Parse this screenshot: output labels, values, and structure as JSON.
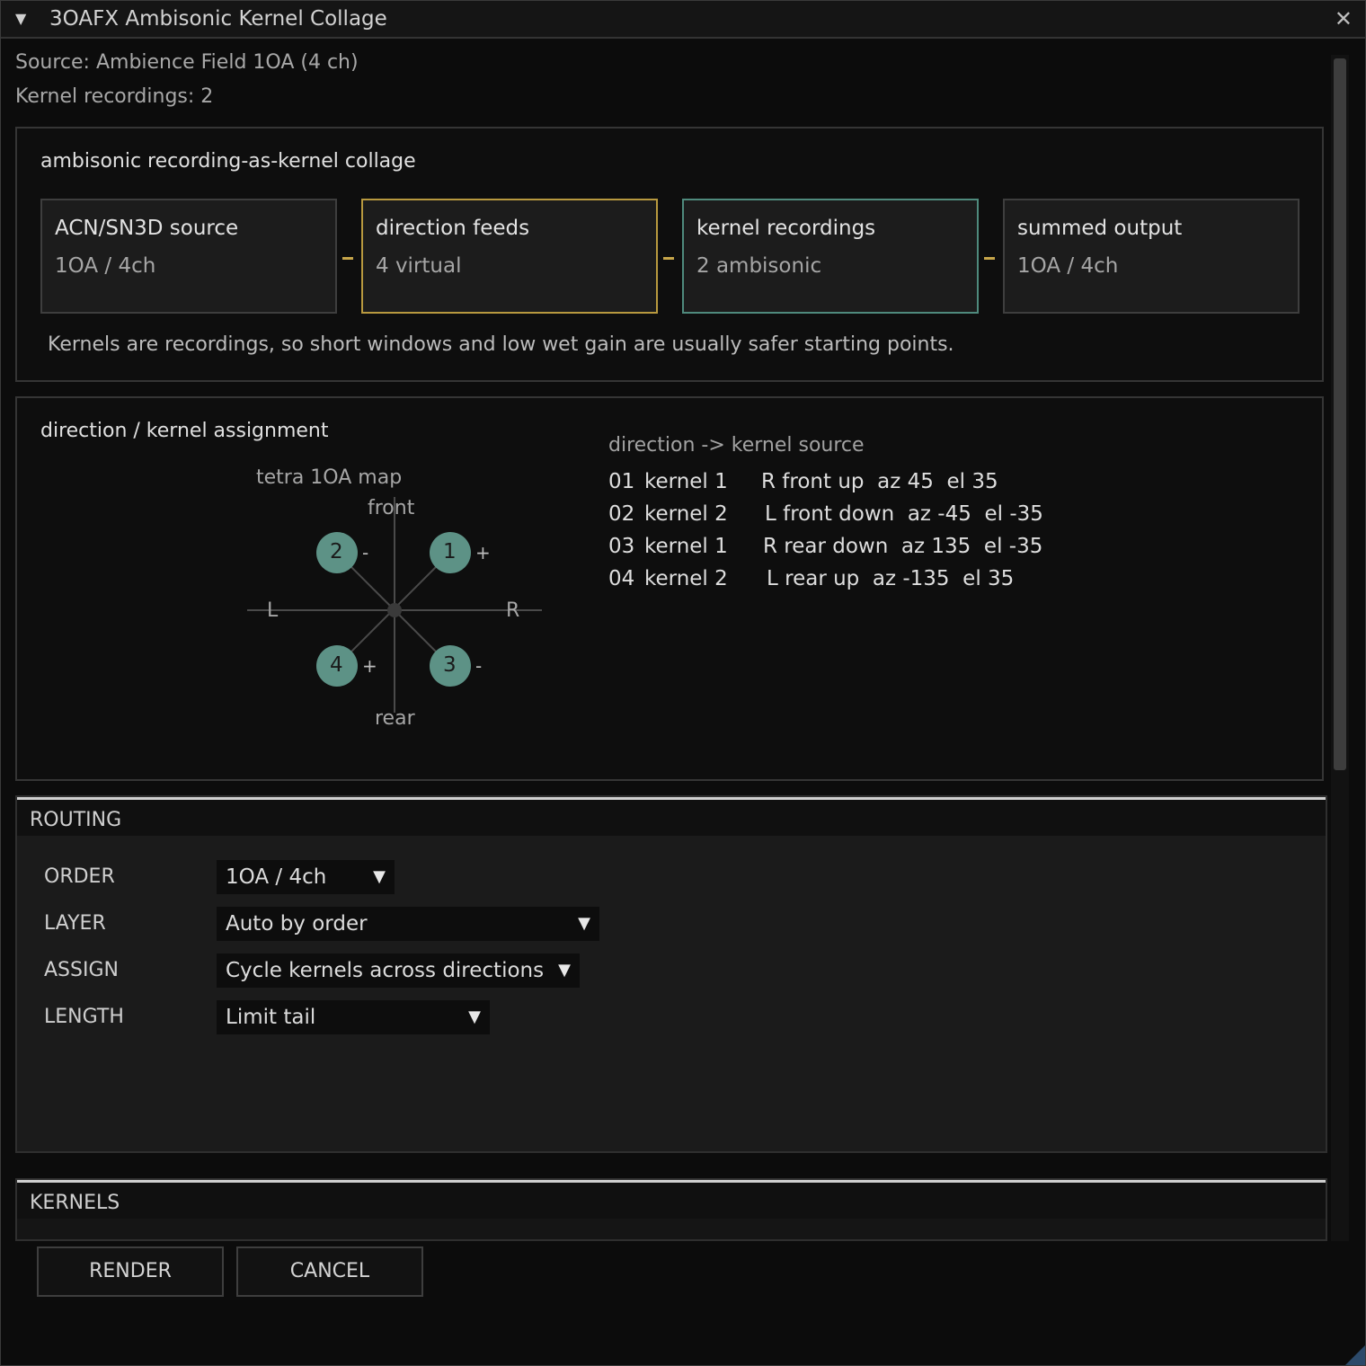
{
  "window": {
    "title": "3OAFX Ambisonic Kernel Collage",
    "collapse_icon": "triangle-down",
    "close_icon": "close-x"
  },
  "info": {
    "source": "Source: Ambience Field 1OA  (4 ch)",
    "kernel_recordings": "Kernel recordings: 2"
  },
  "collage": {
    "title": "ambisonic recording-as-kernel collage",
    "blocks": [
      {
        "title": "ACN/SN3D source",
        "sub": "1OA / 4ch"
      },
      {
        "title": "direction feeds",
        "sub": "4 virtual"
      },
      {
        "title": "kernel recordings",
        "sub": "2 ambisonic"
      },
      {
        "title": "summed output",
        "sub": "1OA / 4ch"
      }
    ],
    "note": "Kernels are recordings, so short windows and low wet gain are usually safer starting points."
  },
  "assignment": {
    "title": "direction / kernel assignment",
    "map": {
      "title": "tetra 1OA map",
      "front": "front",
      "rear": "rear",
      "left": "L",
      "right": "R",
      "nodes": [
        {
          "num": "1",
          "sign": "+"
        },
        {
          "num": "2",
          "sign": "-"
        },
        {
          "num": "3",
          "sign": "-"
        },
        {
          "num": "4",
          "sign": "+"
        }
      ]
    },
    "table_header": "direction -> kernel source",
    "rows": [
      {
        "idx": "01",
        "kernel": "kernel 1",
        "desc": "R front up  az 45  el 35"
      },
      {
        "idx": "02",
        "kernel": "kernel 2",
        "desc": "L front down  az -45  el -35"
      },
      {
        "idx": "03",
        "kernel": "kernel 1",
        "desc": "R rear down  az 135  el -35"
      },
      {
        "idx": "04",
        "kernel": "kernel 2",
        "desc": "L rear up  az -135  el 35"
      }
    ]
  },
  "routing": {
    "label": "ROUTING",
    "fields": [
      {
        "label": "ORDER",
        "value": "1OA / 4ch"
      },
      {
        "label": "LAYER",
        "value": "Auto by order"
      },
      {
        "label": "ASSIGN",
        "value": "Cycle kernels across directions"
      },
      {
        "label": "LENGTH",
        "value": "Limit tail"
      }
    ]
  },
  "kernels": {
    "label": "KERNELS"
  },
  "buttons": {
    "render": "RENDER",
    "cancel": "CANCEL"
  },
  "colors": {
    "accent_yellow": "#b8993f",
    "accent_teal": "#4f8a7d",
    "node_fill": "#5d9286"
  }
}
